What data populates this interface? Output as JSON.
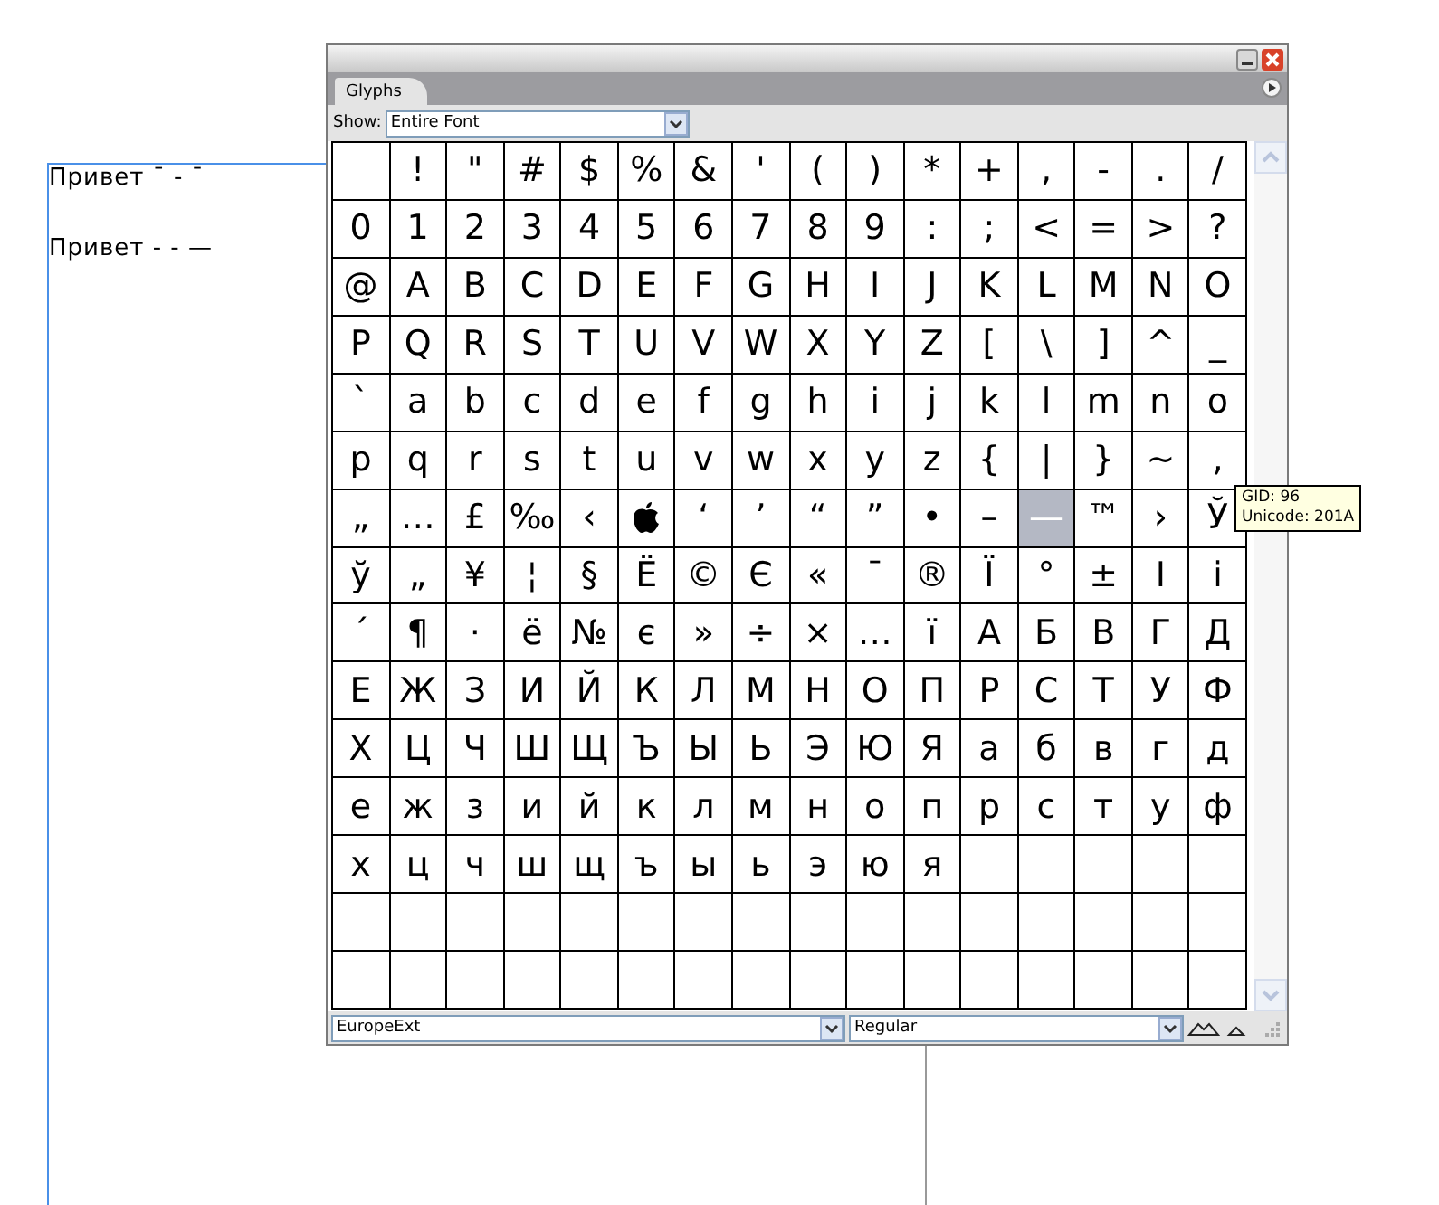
{
  "document": {
    "text_frames": [
      {
        "text": "Привет ¯ - ¯"
      },
      {
        "text": "Привет - - —"
      }
    ]
  },
  "panel": {
    "tabs": [
      {
        "label": "Glyphs",
        "selected": true
      }
    ],
    "show": {
      "label": "Show:",
      "value": "Entire Font"
    },
    "glyph_rows": [
      [
        {
          "selected": false
        },
        {
          "glyph": "!",
          "selected": false
        },
        {
          "glyph": "\"",
          "selected": false
        },
        {
          "glyph": "#",
          "selected": false
        },
        {
          "glyph": "$",
          "selected": false
        },
        {
          "glyph": "%",
          "selected": false
        },
        {
          "glyph": "&",
          "selected": false
        },
        {
          "glyph": "'",
          "selected": false
        },
        {
          "glyph": "(",
          "selected": false
        },
        {
          "glyph": ")",
          "selected": false
        },
        {
          "glyph": "*",
          "selected": false
        },
        {
          "glyph": "+",
          "selected": false
        },
        {
          "glyph": ",",
          "selected": false
        },
        {
          "glyph": "-",
          "selected": false
        },
        {
          "glyph": ".",
          "selected": false
        },
        {
          "glyph": "/",
          "selected": false
        }
      ],
      [
        {
          "glyph": "0",
          "selected": false
        },
        {
          "glyph": "1",
          "selected": false
        },
        {
          "glyph": "2",
          "selected": false
        },
        {
          "glyph": "3",
          "selected": false
        },
        {
          "glyph": "4",
          "selected": false
        },
        {
          "glyph": "5",
          "selected": false
        },
        {
          "glyph": "6",
          "selected": false
        },
        {
          "glyph": "7",
          "selected": false
        },
        {
          "glyph": "8",
          "selected": false
        },
        {
          "glyph": "9",
          "selected": false
        },
        {
          "glyph": ":",
          "selected": false
        },
        {
          "glyph": ";",
          "selected": false
        },
        {
          "glyph": "<",
          "selected": false
        },
        {
          "glyph": "=",
          "selected": false
        },
        {
          "glyph": ">",
          "selected": false
        },
        {
          "glyph": "?",
          "selected": false
        }
      ],
      [
        {
          "glyph": "@",
          "selected": false
        },
        {
          "glyph": "A",
          "selected": false
        },
        {
          "glyph": "B",
          "selected": false
        },
        {
          "glyph": "C",
          "selected": false
        },
        {
          "glyph": "D",
          "selected": false
        },
        {
          "glyph": "E",
          "selected": false
        },
        {
          "glyph": "F",
          "selected": false
        },
        {
          "glyph": "G",
          "selected": false
        },
        {
          "glyph": "H",
          "selected": false
        },
        {
          "glyph": "I",
          "selected": false
        },
        {
          "glyph": "J",
          "selected": false
        },
        {
          "glyph": "K",
          "selected": false
        },
        {
          "glyph": "L",
          "selected": false
        },
        {
          "glyph": "M",
          "selected": false
        },
        {
          "glyph": "N",
          "selected": false
        },
        {
          "glyph": "O",
          "selected": false
        }
      ],
      [
        {
          "glyph": "P",
          "selected": false
        },
        {
          "glyph": "Q",
          "selected": false
        },
        {
          "glyph": "R",
          "selected": false
        },
        {
          "glyph": "S",
          "selected": false
        },
        {
          "glyph": "T",
          "selected": false
        },
        {
          "glyph": "U",
          "selected": false
        },
        {
          "glyph": "V",
          "selected": false
        },
        {
          "glyph": "W",
          "selected": false
        },
        {
          "glyph": "X",
          "selected": false
        },
        {
          "glyph": "Y",
          "selected": false
        },
        {
          "glyph": "Z",
          "selected": false
        },
        {
          "glyph": "[",
          "selected": false
        },
        {
          "glyph": "\\",
          "selected": false
        },
        {
          "glyph": "]",
          "selected": false
        },
        {
          "glyph": "^",
          "selected": false
        },
        {
          "glyph": "_",
          "selected": false
        }
      ],
      [
        {
          "glyph": "`",
          "selected": false
        },
        {
          "glyph": "a",
          "selected": false
        },
        {
          "glyph": "b",
          "selected": false
        },
        {
          "glyph": "c",
          "selected": false
        },
        {
          "glyph": "d",
          "selected": false
        },
        {
          "glyph": "e",
          "selected": false
        },
        {
          "glyph": "f",
          "selected": false
        },
        {
          "glyph": "g",
          "selected": false
        },
        {
          "glyph": "h",
          "selected": false
        },
        {
          "glyph": "i",
          "selected": false
        },
        {
          "glyph": "j",
          "selected": false
        },
        {
          "glyph": "k",
          "selected": false
        },
        {
          "glyph": "l",
          "selected": false
        },
        {
          "glyph": "m",
          "selected": false
        },
        {
          "glyph": "n",
          "selected": false
        },
        {
          "glyph": "o",
          "selected": false
        }
      ],
      [
        {
          "glyph": "p",
          "selected": false
        },
        {
          "glyph": "q",
          "selected": false
        },
        {
          "glyph": "r",
          "selected": false
        },
        {
          "glyph": "s",
          "selected": false
        },
        {
          "glyph": "t",
          "selected": false
        },
        {
          "glyph": "u",
          "selected": false
        },
        {
          "glyph": "v",
          "selected": false
        },
        {
          "glyph": "w",
          "selected": false
        },
        {
          "glyph": "x",
          "selected": false
        },
        {
          "glyph": "y",
          "selected": false
        },
        {
          "glyph": "z",
          "selected": false
        },
        {
          "glyph": "{",
          "selected": false
        },
        {
          "glyph": "|",
          "selected": false
        },
        {
          "glyph": "}",
          "selected": false
        },
        {
          "glyph": "~",
          "selected": false
        },
        {
          "glyph": ",",
          "selected": false
        }
      ],
      [
        {
          "glyph": "„",
          "selected": false
        },
        {
          "glyph": "…",
          "selected": false
        },
        {
          "glyph": "£",
          "selected": false
        },
        {
          "glyph": "‰",
          "selected": false
        },
        {
          "glyph": "‹",
          "selected": false
        },
        {
          "kind": "icon",
          "selected": false
        },
        {
          "glyph": "‘",
          "selected": false
        },
        {
          "glyph": "’",
          "selected": false
        },
        {
          "glyph": "“",
          "selected": false
        },
        {
          "glyph": "”",
          "selected": false
        },
        {
          "glyph": "•",
          "selected": false
        },
        {
          "glyph": "–",
          "selected": false
        },
        {
          "glyph": "—",
          "selected": true
        },
        {
          "glyph": "™",
          "selected": false
        },
        {
          "glyph": "›",
          "selected": false
        },
        {
          "glyph": "Ў",
          "selected": false
        }
      ],
      [
        {
          "glyph": "ў",
          "selected": false
        },
        {
          "glyph": "„",
          "selected": false
        },
        {
          "glyph": "¥",
          "selected": false
        },
        {
          "glyph": "¦",
          "selected": false
        },
        {
          "glyph": "§",
          "selected": false
        },
        {
          "glyph": "Ё",
          "selected": false
        },
        {
          "glyph": "©",
          "selected": false
        },
        {
          "glyph": "Є",
          "selected": false
        },
        {
          "glyph": "«",
          "selected": false
        },
        {
          "glyph": "¯",
          "selected": false
        },
        {
          "glyph": "®",
          "selected": false
        },
        {
          "glyph": "Ї",
          "selected": false
        },
        {
          "glyph": "°",
          "selected": false
        },
        {
          "glyph": "±",
          "selected": false
        },
        {
          "glyph": "І",
          "selected": false
        },
        {
          "glyph": "і",
          "selected": false
        }
      ],
      [
        {
          "glyph": "´",
          "selected": false
        },
        {
          "glyph": "¶",
          "selected": false
        },
        {
          "glyph": "·",
          "selected": false
        },
        {
          "glyph": "ё",
          "selected": false
        },
        {
          "glyph": "№",
          "selected": false
        },
        {
          "glyph": "є",
          "selected": false
        },
        {
          "glyph": "»",
          "selected": false
        },
        {
          "glyph": "÷",
          "selected": false
        },
        {
          "glyph": "×",
          "selected": false
        },
        {
          "glyph": "…",
          "selected": false
        },
        {
          "glyph": "ї",
          "selected": false
        },
        {
          "glyph": "А",
          "selected": false
        },
        {
          "glyph": "Б",
          "selected": false
        },
        {
          "glyph": "В",
          "selected": false
        },
        {
          "glyph": "Г",
          "selected": false
        },
        {
          "glyph": "Д",
          "selected": false
        }
      ],
      [
        {
          "glyph": "Е",
          "selected": false
        },
        {
          "glyph": "Ж",
          "selected": false
        },
        {
          "glyph": "З",
          "selected": false
        },
        {
          "glyph": "И",
          "selected": false
        },
        {
          "glyph": "Й",
          "selected": false
        },
        {
          "glyph": "К",
          "selected": false
        },
        {
          "glyph": "Л",
          "selected": false
        },
        {
          "glyph": "М",
          "selected": false
        },
        {
          "glyph": "Н",
          "selected": false
        },
        {
          "glyph": "О",
          "selected": false
        },
        {
          "glyph": "П",
          "selected": false
        },
        {
          "glyph": "Р",
          "selected": false
        },
        {
          "glyph": "С",
          "selected": false
        },
        {
          "glyph": "Т",
          "selected": false
        },
        {
          "glyph": "У",
          "selected": false
        },
        {
          "glyph": "Ф",
          "selected": false
        }
      ],
      [
        {
          "glyph": "Х",
          "selected": false
        },
        {
          "glyph": "Ц",
          "selected": false
        },
        {
          "glyph": "Ч",
          "selected": false
        },
        {
          "glyph": "Ш",
          "selected": false
        },
        {
          "glyph": "Щ",
          "selected": false
        },
        {
          "glyph": "Ъ",
          "selected": false
        },
        {
          "glyph": "Ы",
          "selected": false
        },
        {
          "glyph": "Ь",
          "selected": false
        },
        {
          "glyph": "Э",
          "selected": false
        },
        {
          "glyph": "Ю",
          "selected": false
        },
        {
          "glyph": "Я",
          "selected": false
        },
        {
          "glyph": "а",
          "selected": false
        },
        {
          "glyph": "б",
          "selected": false
        },
        {
          "glyph": "в",
          "selected": false
        },
        {
          "glyph": "г",
          "selected": false
        },
        {
          "glyph": "д",
          "selected": false
        }
      ],
      [
        {
          "glyph": "е",
          "selected": false
        },
        {
          "glyph": "ж",
          "selected": false
        },
        {
          "glyph": "з",
          "selected": false
        },
        {
          "glyph": "и",
          "selected": false
        },
        {
          "glyph": "й",
          "selected": false
        },
        {
          "glyph": "к",
          "selected": false
        },
        {
          "glyph": "л",
          "selected": false
        },
        {
          "glyph": "м",
          "selected": false
        },
        {
          "glyph": "н",
          "selected": false
        },
        {
          "glyph": "о",
          "selected": false
        },
        {
          "glyph": "п",
          "selected": false
        },
        {
          "glyph": "р",
          "selected": false
        },
        {
          "glyph": "с",
          "selected": false
        },
        {
          "glyph": "т",
          "selected": false
        },
        {
          "glyph": "у",
          "selected": false
        },
        {
          "glyph": "ф",
          "selected": false
        }
      ],
      [
        {
          "glyph": "х",
          "selected": false
        },
        {
          "glyph": "ц",
          "selected": false
        },
        {
          "glyph": "ч",
          "selected": false
        },
        {
          "glyph": "ш",
          "selected": false
        },
        {
          "glyph": "щ",
          "selected": false
        },
        {
          "glyph": "ъ",
          "selected": false
        },
        {
          "glyph": "ы",
          "selected": false
        },
        {
          "glyph": "ь",
          "selected": false
        },
        {
          "glyph": "э",
          "selected": false
        },
        {
          "glyph": "ю",
          "selected": false
        },
        {
          "glyph": "я",
          "selected": false
        },
        {
          "selected": false
        },
        {
          "selected": false
        },
        {
          "selected": false
        },
        {
          "selected": false
        },
        {
          "selected": false
        }
      ],
      [
        {
          "selected": false
        },
        {
          "selected": false
        },
        {
          "selected": false
        },
        {
          "selected": false
        },
        {
          "selected": false
        },
        {
          "selected": false
        },
        {
          "selected": false
        },
        {
          "selected": false
        },
        {
          "selected": false
        },
        {
          "selected": false
        },
        {
          "selected": false
        },
        {
          "selected": false
        },
        {
          "selected": false
        },
        {
          "selected": false
        },
        {
          "selected": false
        },
        {
          "selected": false
        }
      ],
      [
        {
          "selected": false
        },
        {
          "selected": false
        },
        {
          "selected": false
        },
        {
          "selected": false
        },
        {
          "selected": false
        },
        {
          "selected": false
        },
        {
          "selected": false
        },
        {
          "selected": false
        },
        {
          "selected": false
        },
        {
          "selected": false
        },
        {
          "selected": false
        },
        {
          "selected": false
        },
        {
          "selected": false
        },
        {
          "selected": false
        },
        {
          "selected": false
        },
        {
          "selected": false
        }
      ]
    ],
    "tooltip": {
      "lines": [
        "GID: 96",
        "Unicode: 201A"
      ]
    },
    "font_family": "EuropeExt",
    "font_style": "Regular"
  }
}
